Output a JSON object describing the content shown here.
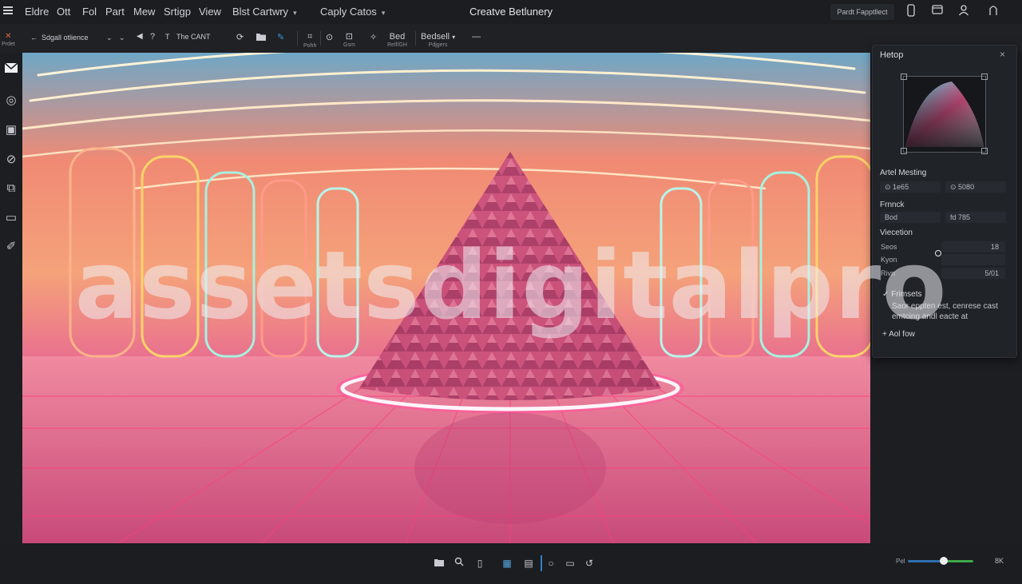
{
  "app": {
    "title": "Creatve Betlunery"
  },
  "menubar": {
    "items": [
      "Eldre",
      "Ott",
      "Fol",
      "Part",
      "Mew",
      "Srtigp",
      "View",
      "Blst Cartwry",
      "Caply Catos"
    ],
    "right_search": "Pardt Fapptllect",
    "icons": [
      "phone-icon",
      "window-icon",
      "user-icon",
      "arch-icon"
    ]
  },
  "toolbar": {
    "breadcrumb": "Sdgall otlience",
    "name_field": "The CANT",
    "stack1": {
      "top": "Bed",
      "bottom": "Relf/GH"
    },
    "stack2": {
      "top": "Bedsell",
      "bottom": "Pdjgers"
    },
    "icon1_label": "Pohh",
    "icon2_label": "Gsm",
    "left_label": "Prdet"
  },
  "left_rail": {
    "icons": [
      "mail-icon",
      "target-icon",
      "calendar-icon",
      "link-icon",
      "puzzle-icon",
      "display-icon",
      "brush-icon"
    ]
  },
  "panel": {
    "title": "Hetop",
    "section1": {
      "title": "Artel Mesting",
      "a": "1e65",
      "b": "5080"
    },
    "section2": {
      "title": "Frnnck",
      "a": "Bod",
      "b": "fd 785"
    },
    "section3": {
      "title": "Viecetion",
      "rows": [
        {
          "label": "Seos",
          "value": "18"
        },
        {
          "label": "Kyon",
          "value": ""
        },
        {
          "label": "Rivn",
          "value": "5/01"
        }
      ]
    },
    "section4": {
      "title": "Frimsets",
      "text": "Saor eppten est, cenrese cast emtcing andl eacte at"
    },
    "add_label": "Aol fow"
  },
  "statusbar": {
    "icons": [
      "folder-icon",
      "search-icon",
      "page-icon",
      "grid-icon",
      "columns-icon",
      "circle-icon",
      "keyboard-icon",
      "history-icon"
    ],
    "zoom_prefix": "Pel",
    "zoom_level": 0.55,
    "zoom_right": "8K"
  },
  "colors": {
    "accent": "#2f6fb0",
    "slider_end": "#3fa84a"
  },
  "watermark": "assetsdigitalpro"
}
